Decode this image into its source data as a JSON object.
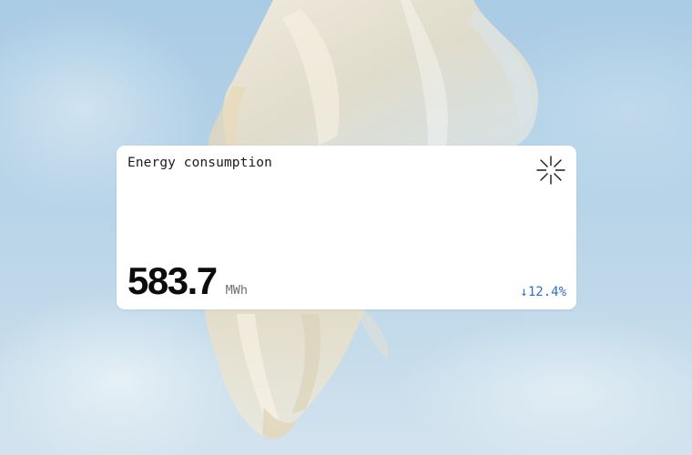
{
  "card": {
    "title": "Energy consumption",
    "icon": "asterisk-sparkle-icon",
    "value": "583.7",
    "unit": "MWh",
    "change": "↓12.4%",
    "change_color": "#2d6fc4"
  },
  "background": {
    "sky_color": "#b8d4e8",
    "fabric_color": "#efe8d6"
  }
}
